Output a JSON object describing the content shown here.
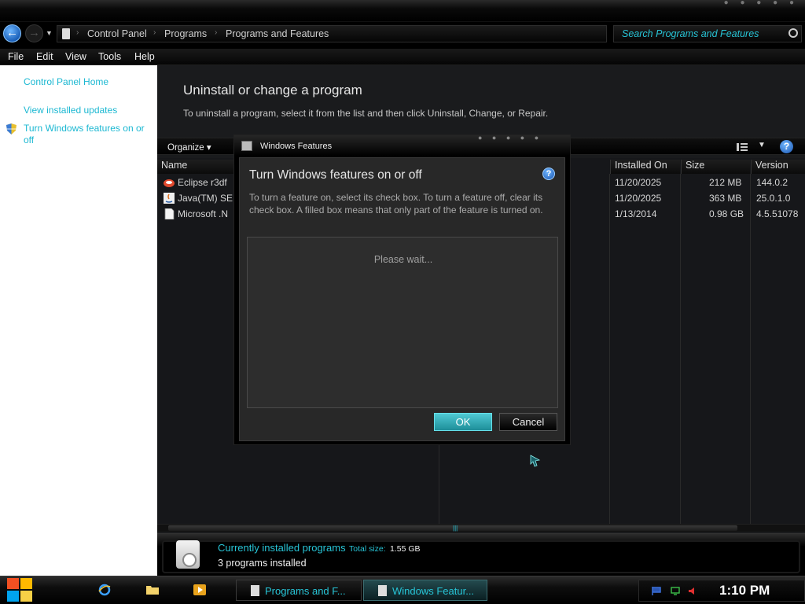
{
  "nav": {
    "breadcrumbs": [
      "Control Panel",
      "Programs",
      "Programs and Features"
    ],
    "search_placeholder": "Search Programs and Features"
  },
  "menu": [
    "File",
    "Edit",
    "View",
    "Tools",
    "Help"
  ],
  "left_pane": {
    "home": "Control Panel Home",
    "updates": "View installed updates",
    "features_line1": "Turn Windows features on or",
    "features_line2": "off"
  },
  "main": {
    "title": "Uninstall or change a program",
    "description": "To uninstall a program, select it from the list and then click Uninstall, Change, or Repair.",
    "organize": "Organize",
    "columns": {
      "name": "Name",
      "installed_on": "Installed On",
      "size": "Size",
      "version": "Version"
    },
    "rows": [
      {
        "name": "Eclipse r3df",
        "installed_on": "11/20/2025",
        "size": "212 MB",
        "version": "144.0.2"
      },
      {
        "name": "Java(TM) SE",
        "installed_on": "11/20/2025",
        "size": "363 MB",
        "version": "25.0.1.0"
      },
      {
        "name": "Microsoft .N",
        "installed_on": "1/13/2014",
        "size": "0.98 GB",
        "version": "4.5.51078"
      }
    ]
  },
  "details": {
    "label": "Currently installed programs",
    "total_label": "Total size:",
    "total_value": "1.55 GB",
    "count": "3 programs installed"
  },
  "dialog": {
    "window_title": "Windows Features",
    "heading": "Turn Windows features on or off",
    "description": "To turn a feature on, select its check box. To turn a feature off, clear its check box. A filled box means that only part of the feature is turned on.",
    "wait": "Please wait...",
    "ok": "OK",
    "cancel": "Cancel"
  },
  "taskbar": {
    "items": [
      "Programs and F...",
      "Windows Featur..."
    ],
    "clock": "1:10 PM"
  },
  "colors": {
    "accent": "#27c4d6",
    "link": "#1cb8d2",
    "background": "#000000"
  },
  "icons": [
    "back-arrow-icon",
    "forward-arrow-icon",
    "search-icon",
    "help-icon",
    "shield-icon",
    "windows-logo-icon",
    "ie-icon",
    "folder-icon",
    "media-player-icon"
  ]
}
